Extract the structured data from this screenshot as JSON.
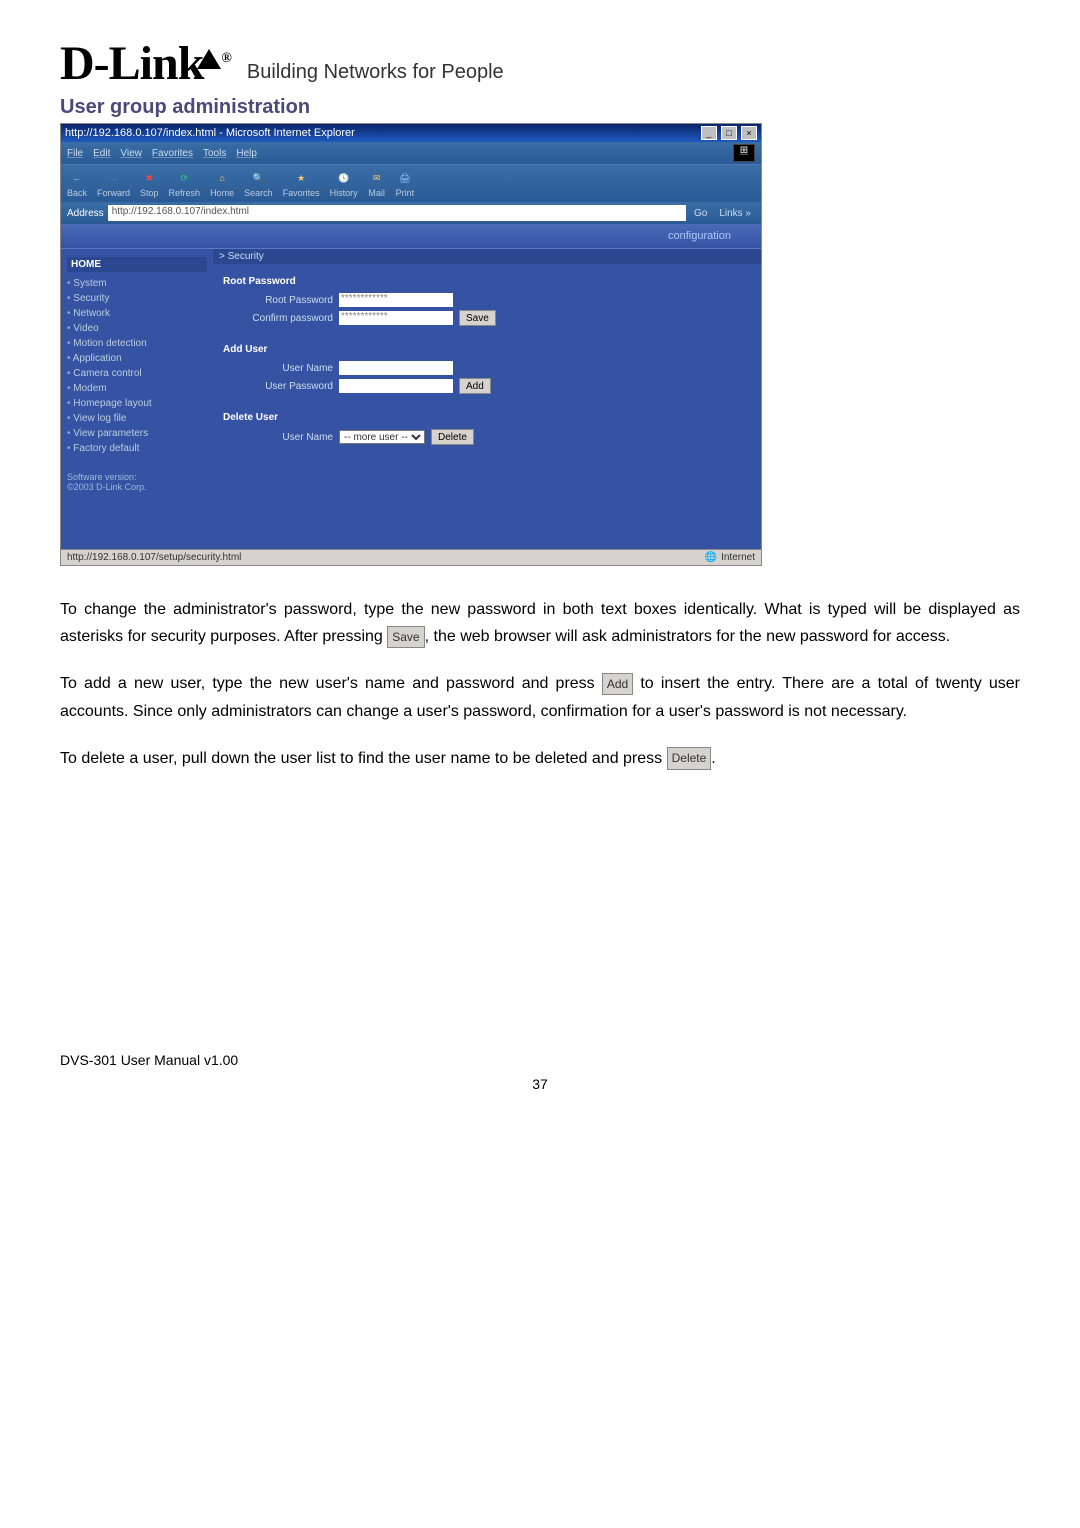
{
  "logo": {
    "text": "D-Link",
    "registered": "®",
    "tagline": "Building Networks for People"
  },
  "section_title": "User group administration",
  "browser": {
    "title": "http://192.168.0.107/index.html - Microsoft Internet Explorer",
    "window_buttons": {
      "min": "_",
      "max": "□",
      "close": "×"
    },
    "menu": {
      "file": "File",
      "edit": "Edit",
      "view": "View",
      "favorites": "Favorites",
      "tools": "Tools",
      "help": "Help"
    },
    "toolbar": {
      "back": "Back",
      "forward": "Forward",
      "stop": "Stop",
      "refresh": "Refresh",
      "home": "Home",
      "search": "Search",
      "favorites": "Favorites",
      "history": "History",
      "mail": "Mail",
      "print": "Print"
    },
    "address_label": "Address",
    "address_value": "http://192.168.0.107/index.html",
    "go": "Go",
    "links": "Links »",
    "tab_label": "configuration",
    "sidebar": {
      "home": "HOME",
      "items": [
        "System",
        "Security",
        "Network",
        "Video",
        "Motion detection",
        "Application",
        "Camera control",
        "Modem",
        "Homepage layout",
        "View log file",
        "View parameters",
        "Factory default"
      ],
      "footer1": "Software version:",
      "footer2": "©2003 D-Link Corp."
    },
    "main": {
      "breadcrumb": "> Security",
      "root_pw_title": "Root Password",
      "root_pw_label": "Root Password",
      "confirm_pw_label": "Confirm password",
      "pw_mask": "************",
      "save_btn": "Save",
      "add_user_title": "Add User",
      "user_name_label": "User Name",
      "user_pw_label": "User Password",
      "add_btn": "Add",
      "delete_user_title": "Delete User",
      "del_user_name_label": "User Name",
      "del_select": "-- more user --",
      "delete_btn": "Delete"
    },
    "status": {
      "left": "http://192.168.0.107/setup/security.html",
      "zone": "Internet"
    }
  },
  "body": {
    "p1a": "To change the administrator's password, type the new password in both text boxes identically. What is typed will be displayed as asterisks for security purposes. After pressing ",
    "btn_save": "Save",
    "p1b": ", the web browser will ask administrators for the new password for access.",
    "p2a": "To add a new user, type the new user's name and password and press ",
    "btn_add": "Add",
    "p2b": " to insert the entry. There are a total of twenty user accounts. Since only administrators can change a user's password, confirmation for a user's password is not necessary.",
    "p3a": "To delete a user, pull down the user list to find the user name to be deleted and press ",
    "btn_delete": "Delete",
    "p3b": "."
  },
  "footer": {
    "left": "DVS-301 User Manual v1.00",
    "page": "37"
  }
}
